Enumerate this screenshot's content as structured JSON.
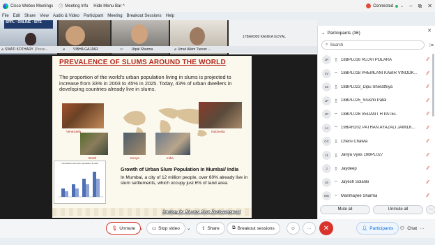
{
  "titlebar": {
    "app_name": "Cisco Webex Meetings",
    "meeting_info": "Meeting Info",
    "hide_menu": "Hide Menu Bar ^",
    "status": "Connected",
    "min": "–",
    "restore": "⧉",
    "close": "✕"
  },
  "menu": [
    "File",
    "Edit",
    "Share",
    "View",
    "Audio & Video",
    "Participant",
    "Meeting",
    "Help",
    "Breakout Sessions"
  ],
  "video_tiles": [
    {
      "name": "SWATI KOTHARY",
      "extra": "(Prese..."
    },
    {
      "name": "VIBHA GAJJAR"
    },
    {
      "name": "Utpal Sharma"
    },
    {
      "name": "Umut Alkim Tuncer ..."
    },
    {
      "name": "17BAR009 KANIKA GOYAL"
    }
  ],
  "slide": {
    "title": "PREVALENCE OF SLUMS AROUND THE WORLD",
    "body": "The proportion of the world’s urban population living in slums is projected to increase from 33% in 2003 to 45% in 2025. Today, 43% of urban dwellers in developing countries already live in slums.",
    "captions": [
      "Venezuela",
      "Kenya",
      "Brazil",
      "Indonesia",
      "India"
    ],
    "chart_title": "comparison bet slum population & india",
    "growth_title": "Growth of Urban Slum Population in Mumbai/ India",
    "growth_body": "In Mumbai, a city of 12 million people, over 60% already live in slum settlements, which occupy just 6% of land area.",
    "footer_link": "Strategy for Dharavi Slum Redevelopment"
  },
  "participants": {
    "header": "Participants (36)",
    "search_placeholder": "Search",
    "list": [
      {
        "initials": "1P",
        "name": "18BPL016 RUJVI POLARA",
        "icon": "phone-icon"
      },
      {
        "initials": "1V",
        "name": "18BPL018 PREMLANI KABIR VINODK...",
        "icon": "video-icon"
      },
      {
        "initials": "1S",
        "name": "18BPL023_Dipu Sherathiya",
        "icon": "phone-icon"
      },
      {
        "initials": "1P",
        "name": "18BPL025_Srushti Patel",
        "icon": "phone-icon"
      },
      {
        "initials": "1P",
        "name": "18BPL026 VEDANT H PATEL",
        "icon": "video-icon"
      },
      {
        "initials": "1J",
        "name": "19BAR202 PATHAN AYAZALI JAMILK...",
        "icon": "video-icon"
      },
      {
        "initials": "CC",
        "name": "Chelsi Chawla",
        "icon": "phone-icon"
      },
      {
        "initials": "J1",
        "name": "Janya Vyas 18BPL027",
        "icon": "phone-icon"
      },
      {
        "initials": "J",
        "name": "Jaydeep",
        "icon": "phone-icon"
      },
      {
        "initials": "JS",
        "name": "Jayesh Solanki",
        "icon": "video-icon"
      },
      {
        "initials": "MS",
        "name": "Manmayee Sharma",
        "icon": "video-icon"
      }
    ],
    "mute_all": "Mute all",
    "unmute_all": "Unmute all",
    "more": "···"
  },
  "controls": {
    "unmute": "Unmute",
    "stop_video": "Stop video",
    "share": "Share",
    "breakout": "Breakout sessions",
    "participants": "Participants",
    "chat": "Chat",
    "more": "···"
  },
  "colors": {
    "accent": "#0d6bd6",
    "danger": "#d9342b",
    "slide_title": "#b2281f"
  }
}
